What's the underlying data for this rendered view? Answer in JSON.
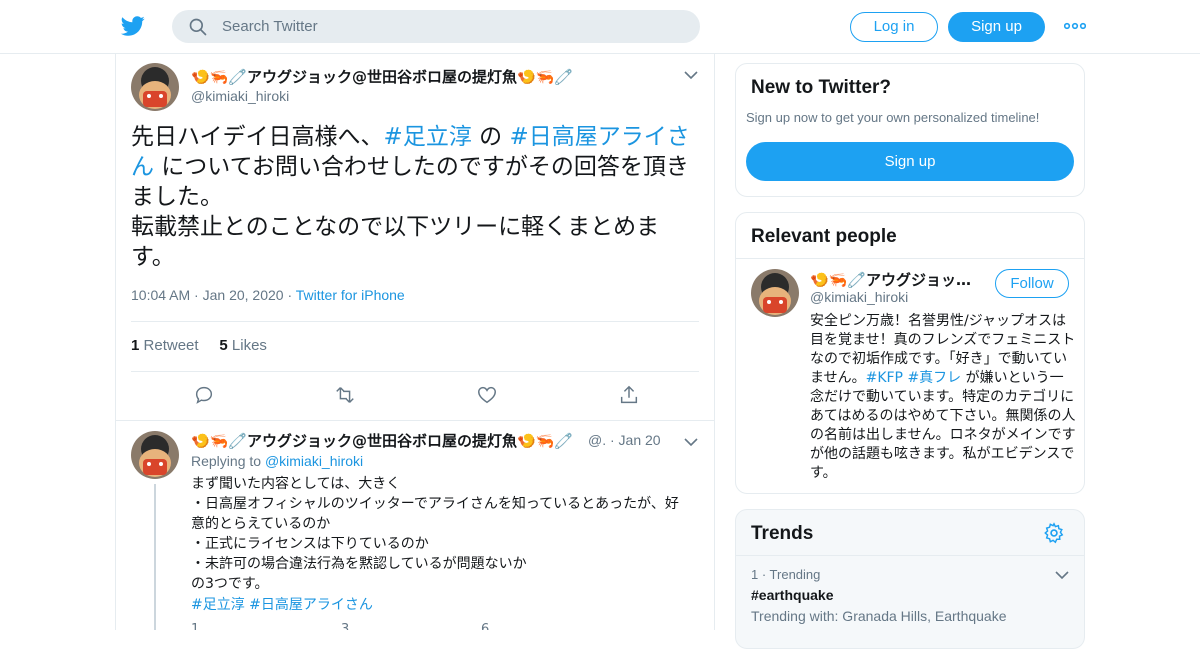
{
  "header": {
    "search_placeholder": "Search Twitter",
    "login_label": "Log in",
    "signup_label": "Sign up"
  },
  "tweet": {
    "name": "🍤🦐🧷アウグジョック@世田谷ボロ屋の提灯魚🍤🦐🧷",
    "handle": "@kimiaki_hiroki",
    "text_1": "先日ハイデイ日高様へ、",
    "tag_1": "#足立淳",
    "text_2": " の ",
    "tag_2": "#日高屋アライさん",
    "text_3": " についてお問い合わせしたのですがその回答を頂きました。",
    "text_4": "転載禁止とのことなので以下ツリーに軽くまとめます。",
    "time": "10:04 AM",
    "date": "Jan 20, 2020",
    "source": "Twitter for iPhone",
    "retweet_count": "1",
    "retweet_label": "Retweet",
    "like_count": "5",
    "like_label": "Likes"
  },
  "reply": {
    "name": "🍤🦐🧷アウグジョック@世田谷ボロ屋の提灯魚🍤🦐🧷",
    "handle_date": "@. · Jan 20",
    "replying_label": "Replying to",
    "replying_to": "@kimiaki_hiroki",
    "text": "まず聞いた内容としては、大きく\n・日高屋オフィシャルのツイッターでアライさんを知っているとあったが、好意的とらえているのか\n・正式にライセンスは下りているのか\n・未許可の場合違法行為を黙認しているが問題ないか\nの3つです。",
    "tags": "#足立淳 #日高屋アライさん",
    "reply_count": "1",
    "retweet_count": "3",
    "like_count": "6"
  },
  "new_to_twitter": {
    "title": "New to Twitter?",
    "subtitle": "Sign up now to get your own personalized timeline!",
    "button": "Sign up"
  },
  "relevant": {
    "title": "Relevant people",
    "name": "🍤🦐🧷アウグジョッ…",
    "handle": "@kimiaki_hiroki",
    "follow": "Follow",
    "bio_1": "安全ピン万歳！名誉男性/ジャップオスは目を覚ませ！真のフレンズでフェミニストなので初垢作成です。「好き」で動いていません。",
    "bio_tag_1": "#KFP",
    "bio_tag_2": "#真フレ",
    "bio_2": " が嫌いという一念だけで動いています。特定のカテゴリにあてはめるのはやめて下さい。無関係の人の名前は出しません。ロネタがメインですが他の話題も呟きます。私がエビデンスです。"
  },
  "trends": {
    "title": "Trends",
    "meta": "1 · Trending",
    "name": "#earthquake",
    "with": "Trending with: Granada Hills, Earthquake"
  },
  "colors": {
    "brand": "#1da1f2",
    "link": "#1b95e0",
    "muted": "#657786"
  }
}
